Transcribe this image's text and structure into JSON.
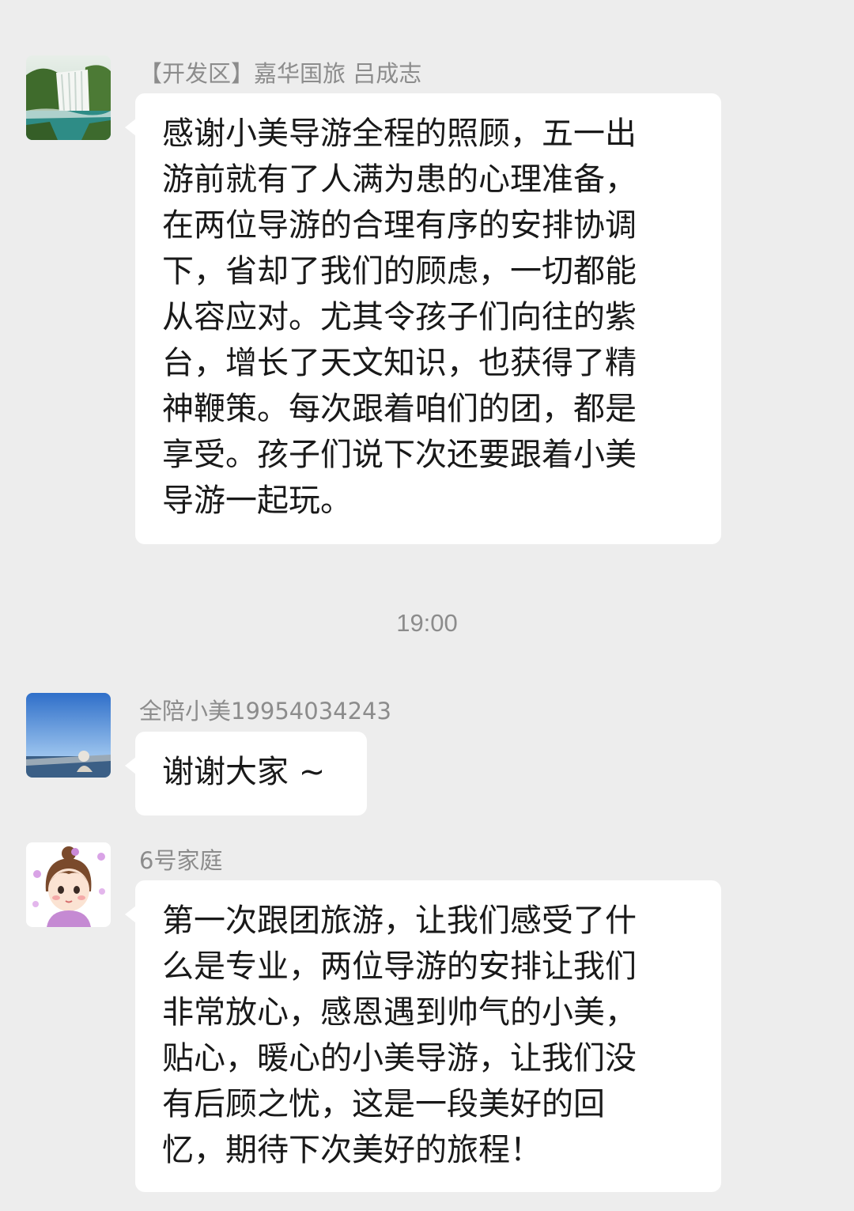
{
  "messages": [
    {
      "sender": "【开发区】嘉华国旅  吕成志",
      "avatar": "waterfall-landscape-avatar",
      "lines": [
        "感谢小美导游全程的照顾，五一出",
        "游前就有了人满为患的心理准备，",
        "在两位导游的合理有序的安排协调",
        "下，省却了我们的顾虑，一切都能",
        "从容应对。尤其令孩子们向往的紫",
        "台，增长了天文知识，也获得了精",
        "神鞭策。每次跟着咱们的团，都是",
        "享受。孩子们说下次还要跟着小美",
        "导游一起玩。"
      ]
    },
    {
      "sender": "全陪小美19954034243",
      "avatar": "blue-sky-avatar",
      "lines": [
        "谢谢大家 ~"
      ]
    },
    {
      "sender": "6号家庭",
      "avatar": "cartoon-girl-avatar",
      "lines": [
        "第一次跟团旅游，让我们感受了什",
        "么是专业，两位导游的安排让我们",
        "非常放心，感恩遇到帅气的小美，",
        "贴心，暖心的小美导游，让我们没",
        "有后顾之忧，这是一段美好的回",
        "忆，期待下次美好的旅程！"
      ]
    }
  ],
  "timestamp": "19:00",
  "colors": {
    "background": "#ededed",
    "bubble": "#ffffff",
    "sender_text": "#8c8c8c",
    "message_text": "#191919"
  }
}
